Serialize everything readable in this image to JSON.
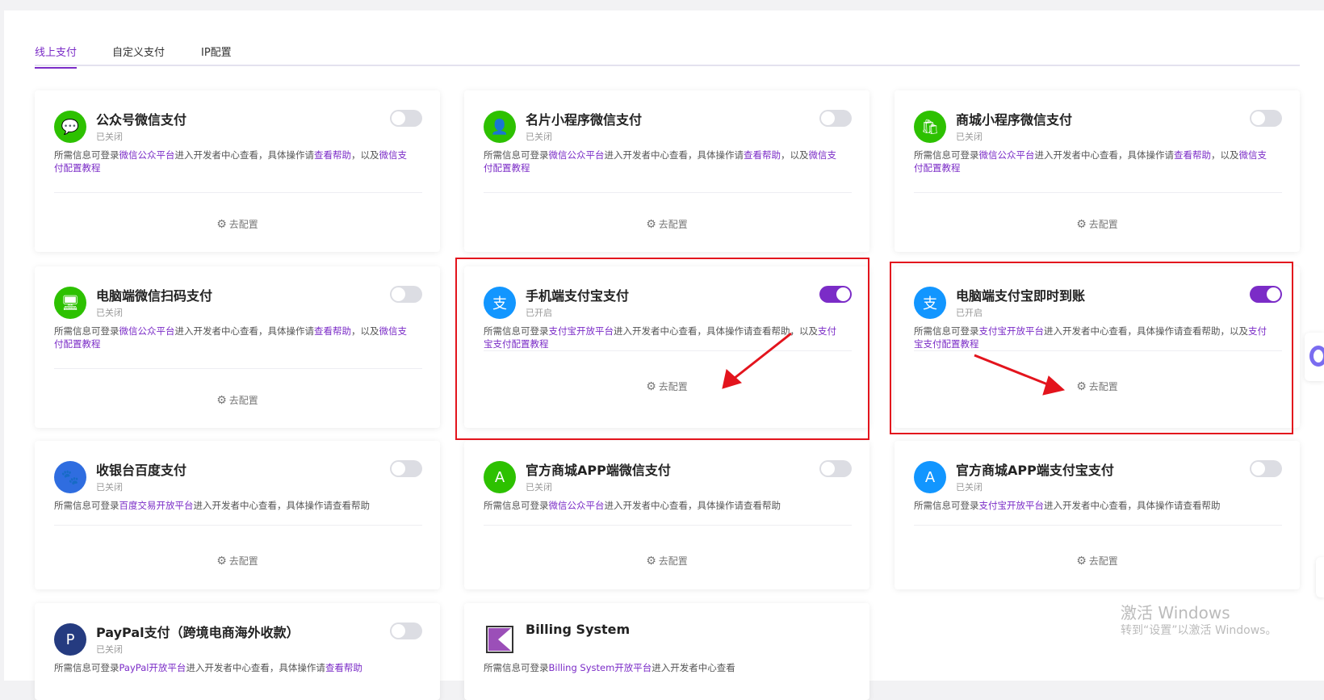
{
  "tabs": [
    "线上支付",
    "自定义支付",
    "IP配置"
  ],
  "config_label": "去配置",
  "colors": {
    "accent": "#7b2cc7",
    "wechat": "#2dc100",
    "alipay": "#1296ff",
    "annotation": "#e3141d"
  },
  "cards": [
    {
      "title": "公众号微信支付",
      "status": "已关闭",
      "enabled": false,
      "icon": "wechat-icon",
      "desc": [
        {
          "t": "所需信息可登录"
        },
        {
          "t": "微信公众平台",
          "l": 1
        },
        {
          "t": "进入开发者中心查看，具体操作请"
        },
        {
          "t": "查看帮助",
          "l": 1
        },
        {
          "t": "，以及"
        },
        {
          "t": "微信支付配置教程",
          "l": 1
        }
      ]
    },
    {
      "title": "名片小程序微信支付",
      "status": "已关闭",
      "enabled": false,
      "icon": "wechat-card-icon",
      "desc": [
        {
          "t": "所需信息可登录"
        },
        {
          "t": "微信公众平台",
          "l": 1
        },
        {
          "t": "进入开发者中心查看，具体操作请"
        },
        {
          "t": "查看帮助",
          "l": 1
        },
        {
          "t": "，以及"
        },
        {
          "t": "微信支付配置教程",
          "l": 1
        }
      ]
    },
    {
      "title": "商城小程序微信支付",
      "status": "已关闭",
      "enabled": false,
      "icon": "wechat-shop-icon",
      "desc": [
        {
          "t": "所需信息可登录"
        },
        {
          "t": "微信公众平台",
          "l": 1
        },
        {
          "t": "进入开发者中心查看，具体操作请"
        },
        {
          "t": "查看帮助",
          "l": 1
        },
        {
          "t": "，以及"
        },
        {
          "t": "微信支付配置教程",
          "l": 1
        }
      ]
    },
    {
      "title": "电脑端微信扫码支付",
      "status": "已关闭",
      "enabled": false,
      "icon": "wechat-pc-icon",
      "desc": [
        {
          "t": "所需信息可登录"
        },
        {
          "t": "微信公众平台",
          "l": 1
        },
        {
          "t": "进入开发者中心查看，具体操作请"
        },
        {
          "t": "查看帮助",
          "l": 1
        },
        {
          "t": "，以及"
        },
        {
          "t": "微信支付配置教程",
          "l": 1
        }
      ]
    },
    {
      "title": "手机端支付宝支付",
      "status": "已开启",
      "enabled": true,
      "icon": "alipay-mobile-icon",
      "desc": [
        {
          "t": "所需信息可登录"
        },
        {
          "t": "支付宝开放平台",
          "l": 1
        },
        {
          "t": "进入开发者中心查看，具体操作请查看帮助，以及"
        },
        {
          "t": "支付宝支付配置教程",
          "l": 1
        }
      ]
    },
    {
      "title": "电脑端支付宝即时到账",
      "status": "已开启",
      "enabled": true,
      "icon": "alipay-pc-icon",
      "desc": [
        {
          "t": "所需信息可登录"
        },
        {
          "t": "支付宝开放平台",
          "l": 1
        },
        {
          "t": "进入开发者中心查看，具体操作请查看帮助，以及"
        },
        {
          "t": "支付宝支付配置教程",
          "l": 1
        }
      ]
    },
    {
      "title": "收银台百度支付",
      "status": "已关闭",
      "enabled": false,
      "icon": "baidu-pay-icon",
      "desc": [
        {
          "t": "所需信息可登录"
        },
        {
          "t": "百度交易开放平台",
          "l": 1
        },
        {
          "t": "进入开发者中心查看，具体操作请查看帮助"
        }
      ]
    },
    {
      "title": "官方商城APP端微信支付",
      "status": "已关闭",
      "enabled": false,
      "icon": "wechat-app-icon",
      "desc": [
        {
          "t": "所需信息可登录"
        },
        {
          "t": "微信公众平台",
          "l": 1
        },
        {
          "t": "进入开发者中心查看，具体操作请查看帮助"
        }
      ]
    },
    {
      "title": "官方商城APP端支付宝支付",
      "status": "已关闭",
      "enabled": false,
      "icon": "alipay-app-icon",
      "desc": [
        {
          "t": "所需信息可登录"
        },
        {
          "t": "支付宝开放平台",
          "l": 1
        },
        {
          "t": "进入开发者中心查看，具体操作请查看帮助"
        }
      ]
    },
    {
      "title": "PayPal支付（跨境电商海外收款）",
      "status": "已关闭",
      "enabled": false,
      "icon": "paypal-icon",
      "desc": [
        {
          "t": "所需信息可登录"
        },
        {
          "t": "PayPal开放平台",
          "l": 1
        },
        {
          "t": "进入开发者中心查看，具体操作请"
        },
        {
          "t": "查看帮助",
          "l": 1
        }
      ]
    },
    {
      "title": "Billing System",
      "status": "",
      "enabled": null,
      "icon": "billing-system-icon",
      "desc": [
        {
          "t": "所需信息可登录"
        },
        {
          "t": "Billing System开放平台",
          "l": 1
        },
        {
          "t": "进入开发者中心查看"
        }
      ]
    }
  ],
  "watermark": {
    "line1": "激活 Windows",
    "line2": "转到“设置”以激活 Windows。"
  }
}
